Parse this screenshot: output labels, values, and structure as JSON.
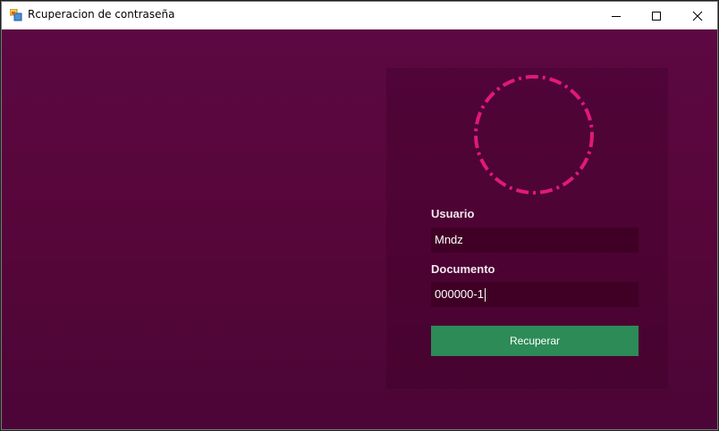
{
  "window": {
    "title": "Rcuperacion de contraseña",
    "controls": {
      "minimize_icon": "minimize-icon",
      "maximize_icon": "maximize-icon",
      "close_icon": "close-icon"
    }
  },
  "form": {
    "avatar_icon": "dashed-circle-icon",
    "user_label": "Usuario",
    "user_value": "Mndz",
    "doc_label": "Documento",
    "doc_value": "000000-1",
    "submit_label": "Recuperar"
  },
  "colors": {
    "background": "#5c0842",
    "panel": "#4a0533",
    "field": "#400026",
    "ring": "#e0197a",
    "button": "#2d8b57"
  }
}
